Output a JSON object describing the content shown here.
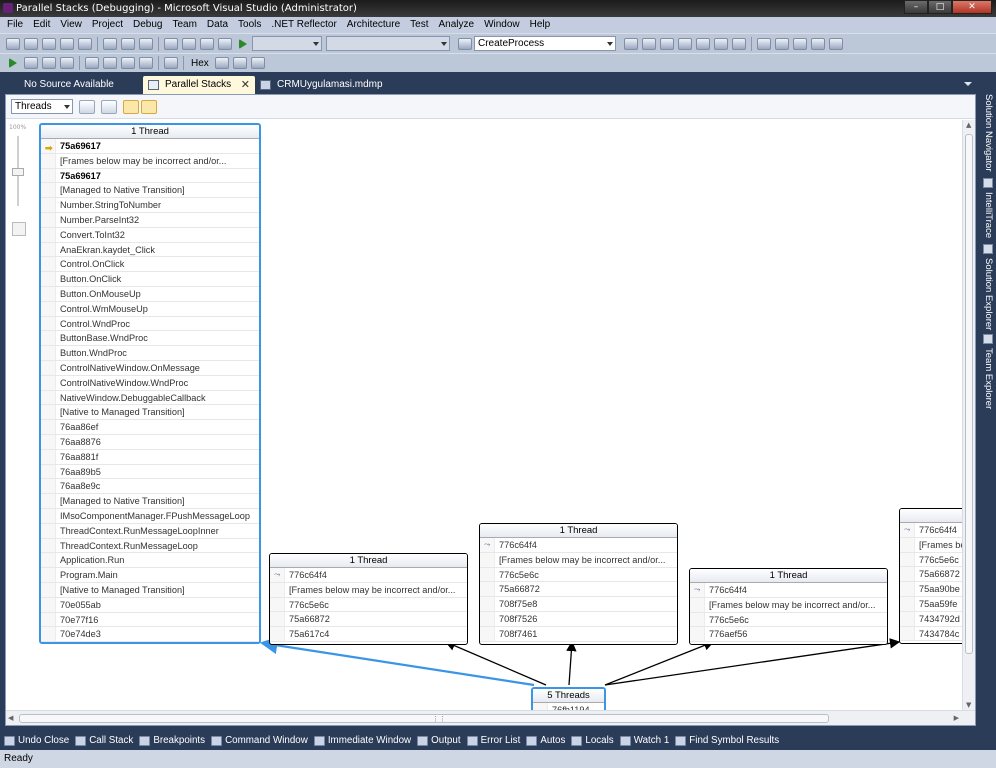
{
  "window": {
    "title": "Parallel Stacks (Debugging) - Microsoft Visual Studio (Administrator)"
  },
  "menu": [
    "File",
    "Edit",
    "View",
    "Project",
    "Debug",
    "Team",
    "Data",
    "Tools",
    ".NET Reflector",
    "Architecture",
    "Test",
    "Analyze",
    "Window",
    "Help"
  ],
  "toolbar": {
    "find_combo_value": "CreateProcess",
    "hex_label": "Hex"
  },
  "tabs": [
    {
      "label": "No Source Available",
      "active": false
    },
    {
      "label": "Parallel Stacks",
      "active": true
    },
    {
      "label": "CRMUygulamasi.mdmp",
      "active": false
    }
  ],
  "parallel_stacks": {
    "view_combo": "Threads",
    "zoom_label": "100%",
    "nodes": [
      {
        "header": "1 Thread",
        "frames": [
          {
            "text": "75a69617",
            "bold": true,
            "current": true
          },
          {
            "text": "[Frames below may be incorrect and/or..."
          },
          {
            "text": "75a69617",
            "bold": true
          },
          {
            "text": "[Managed to Native Transition]"
          },
          {
            "text": "Number.StringToNumber"
          },
          {
            "text": "Number.ParseInt32"
          },
          {
            "text": "Convert.ToInt32"
          },
          {
            "text": "AnaEkran.kaydet_Click"
          },
          {
            "text": "Control.OnClick"
          },
          {
            "text": "Button.OnClick"
          },
          {
            "text": "Button.OnMouseUp"
          },
          {
            "text": "Control.WmMouseUp"
          },
          {
            "text": "Control.WndProc"
          },
          {
            "text": "ButtonBase.WndProc"
          },
          {
            "text": "Button.WndProc"
          },
          {
            "text": "ControlNativeWindow.OnMessage"
          },
          {
            "text": "ControlNativeWindow.WndProc"
          },
          {
            "text": "NativeWindow.DebuggableCallback"
          },
          {
            "text": "[Native to Managed Transition]"
          },
          {
            "text": "76aa86ef"
          },
          {
            "text": "76aa8876"
          },
          {
            "text": "76aa881f"
          },
          {
            "text": "76aa89b5"
          },
          {
            "text": "76aa8e9c"
          },
          {
            "text": "[Managed to Native Transition]"
          },
          {
            "text": "IMsoComponentManager.FPushMessageLoop"
          },
          {
            "text": "ThreadContext.RunMessageLoopInner"
          },
          {
            "text": "ThreadContext.RunMessageLoop"
          },
          {
            "text": "Application.Run"
          },
          {
            "text": "Program.Main"
          },
          {
            "text": "[Native to Managed Transition]"
          },
          {
            "text": "70e055ab"
          },
          {
            "text": "70e77f16"
          },
          {
            "text": "70e74de3"
          }
        ]
      },
      {
        "header": "1 Thread",
        "frames": [
          {
            "text": "776c64f4",
            "thread": true
          },
          {
            "text": "[Frames below may be incorrect and/or..."
          },
          {
            "text": "776c5e6c"
          },
          {
            "text": "75a66872"
          },
          {
            "text": "75a617c4"
          }
        ]
      },
      {
        "header": "1 Thread",
        "frames": [
          {
            "text": "776c64f4",
            "thread": true
          },
          {
            "text": "[Frames below may be incorrect and/or..."
          },
          {
            "text": "776c5e6c"
          },
          {
            "text": "75a66872"
          },
          {
            "text": "708f75e8"
          },
          {
            "text": "708f7526"
          },
          {
            "text": "708f7461"
          }
        ]
      },
      {
        "header": "1 Thread",
        "frames": [
          {
            "text": "776c64f4",
            "thread": true
          },
          {
            "text": "[Frames below may be incorrect and/or..."
          },
          {
            "text": "776c5e6c"
          },
          {
            "text": "776aef56"
          }
        ]
      },
      {
        "header": "",
        "frames": [
          {
            "text": "776c64f4",
            "thread": true
          },
          {
            "text": "[Frames be"
          },
          {
            "text": "776c5e6c"
          },
          {
            "text": "75a66872"
          },
          {
            "text": "75aa90be"
          },
          {
            "text": "75aa59fe"
          },
          {
            "text": "7434792d"
          },
          {
            "text": "7434784c"
          }
        ]
      },
      {
        "header": "5 Threads",
        "frames": [
          {
            "text": "76fb1194"
          }
        ]
      }
    ]
  },
  "side_tabs": [
    "Solution Navigator",
    "IntelliTrace",
    "Solution Explorer",
    "Team Explorer"
  ],
  "bottom_tabs": [
    "Undo Close",
    "Call Stack",
    "Breakpoints",
    "Command Window",
    "Immediate Window",
    "Output",
    "Error List",
    "Autos",
    "Locals",
    "Watch 1",
    "Find Symbol Results"
  ],
  "status": {
    "text": "Ready"
  },
  "colors": {
    "selected_node_border": "#3b95e6",
    "chrome_dark": "#2b3c59",
    "current_frame_arrow": "#d8a700"
  }
}
